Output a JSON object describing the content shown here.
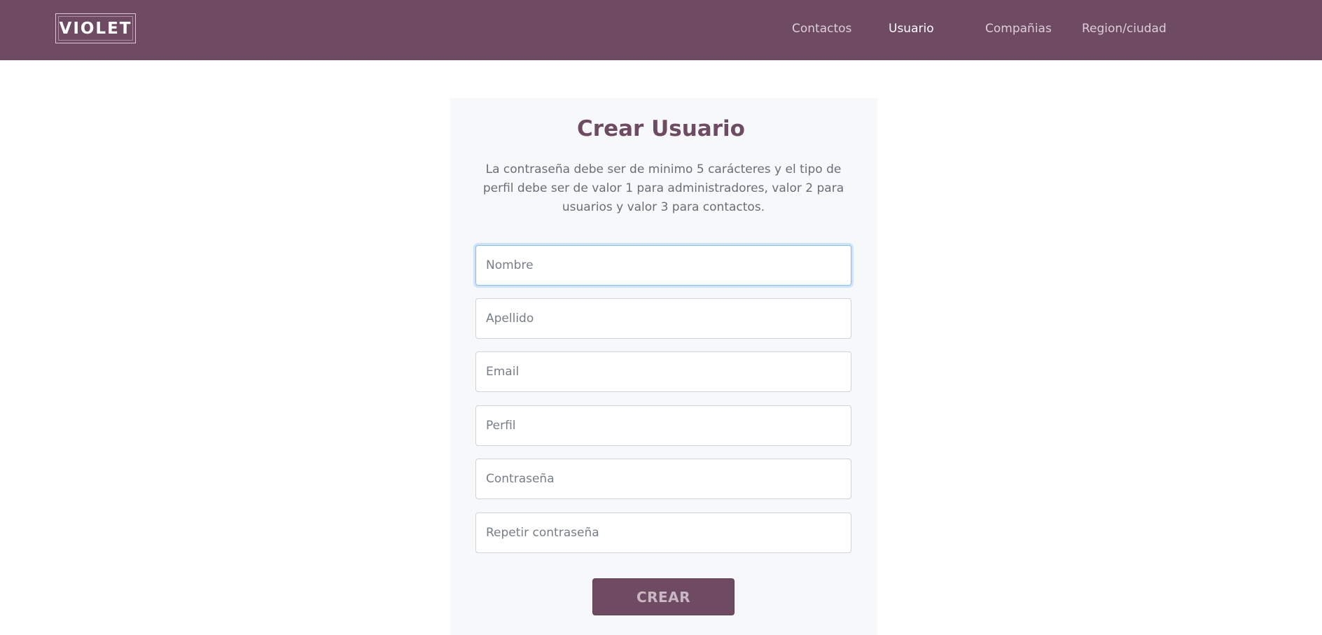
{
  "navbar": {
    "logo_text": "VIOLET",
    "links": [
      {
        "label": "Contactos"
      },
      {
        "label": "Usuario"
      },
      {
        "label": "Compañias"
      },
      {
        "label": "Region/ciudad"
      }
    ]
  },
  "form": {
    "title": "Crear Usuario",
    "description": "La contraseña debe ser de minimo 5 carácteres y el tipo de perfil debe ser de valor 1 para administradores, valor 2 para usuarios y valor 3 para contactos.",
    "fields": [
      {
        "placeholder": "Nombre",
        "value": ""
      },
      {
        "placeholder": "Apellido",
        "value": ""
      },
      {
        "placeholder": "Email",
        "value": ""
      },
      {
        "placeholder": "Perfil",
        "value": ""
      },
      {
        "placeholder": "Contraseña",
        "value": ""
      },
      {
        "placeholder": "Repetir contraseña",
        "value": ""
      }
    ],
    "submit_label": "CREAR"
  },
  "colors": {
    "brand": "#6e4b62",
    "card_background": "#f7f8fa",
    "focus_ring": "#80bdff"
  }
}
